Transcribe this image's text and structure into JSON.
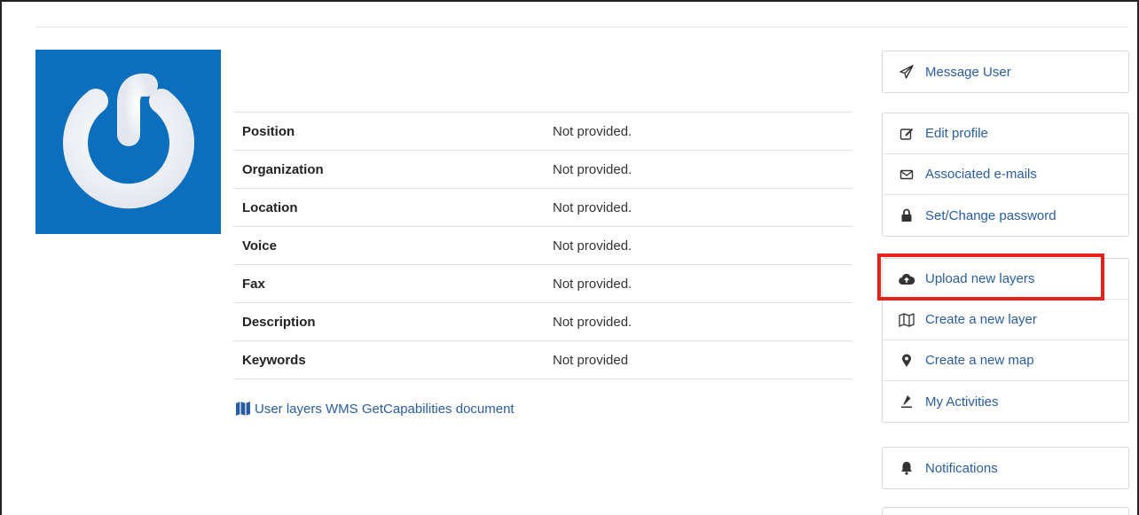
{
  "profile": {
    "rows": [
      {
        "label": "Position",
        "value": "Not provided."
      },
      {
        "label": "Organization",
        "value": "Not provided."
      },
      {
        "label": "Location",
        "value": "Not provided."
      },
      {
        "label": "Voice",
        "value": "Not provided."
      },
      {
        "label": "Fax",
        "value": "Not provided."
      },
      {
        "label": "Description",
        "value": "Not provided."
      },
      {
        "label": "Keywords",
        "value": "Not provided"
      }
    ],
    "wms_link": "User layers WMS GetCapabilities document"
  },
  "actions": {
    "message_user": "Message User",
    "edit_profile": "Edit profile",
    "associated_emails": "Associated e-mails",
    "set_password": "Set/Change password",
    "upload_layers": "Upload new layers",
    "create_layer": "Create a new layer",
    "create_map": "Create a new map",
    "my_activities": "My Activities",
    "notifications": "Notifications"
  },
  "colors": {
    "avatar_bg": "#0b6fbd",
    "link": "#2a5d9f",
    "highlight": "#e8211c"
  },
  "icons": {
    "message_user": "paper-plane-icon",
    "edit_profile": "edit-icon",
    "associated_emails": "envelope-icon",
    "set_password": "lock-icon",
    "upload_layers": "cloud-upload-icon",
    "create_layer": "map-outline-icon",
    "create_map": "map-marker-icon",
    "my_activities": "activity-icon",
    "notifications": "bell-icon",
    "wms_link": "map-icon"
  }
}
